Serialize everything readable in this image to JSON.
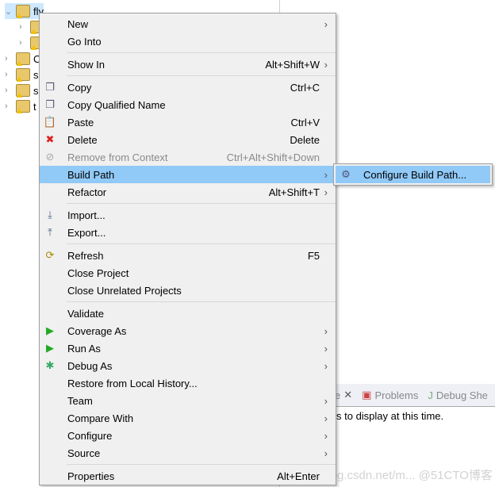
{
  "tree": {
    "items": [
      {
        "label": "fly",
        "expanded": true,
        "selected": true
      },
      {
        "label": "",
        "child": true,
        "icon": "library-icon"
      },
      {
        "label": "",
        "child": true,
        "icon": "package-icon"
      },
      {
        "label": "C"
      },
      {
        "label": "s"
      },
      {
        "label": "s"
      },
      {
        "label": "t"
      }
    ]
  },
  "bottom": {
    "tabs": [
      {
        "label": "e"
      },
      {
        "label": "Problems"
      },
      {
        "label": "Debug She"
      }
    ],
    "message": "s to display at this time."
  },
  "menu": {
    "items": [
      {
        "label": "New",
        "arrow": true
      },
      {
        "label": "Go Into"
      },
      {
        "sep": true
      },
      {
        "label": "Show In",
        "shortcut": "Alt+Shift+W",
        "arrow": true
      },
      {
        "sep": true
      },
      {
        "label": "Copy",
        "shortcut": "Ctrl+C",
        "icon": "copy-icon"
      },
      {
        "label": "Copy Qualified Name",
        "icon": "copy-qualified-icon"
      },
      {
        "label": "Paste",
        "shortcut": "Ctrl+V",
        "icon": "paste-icon"
      },
      {
        "label": "Delete",
        "shortcut": "Delete",
        "icon": "delete-icon"
      },
      {
        "label": "Remove from Context",
        "shortcut": "Ctrl+Alt+Shift+Down",
        "disabled": true,
        "icon": "remove-context-icon"
      },
      {
        "label": "Build Path",
        "arrow": true,
        "highlighted": true
      },
      {
        "label": "Refactor",
        "shortcut": "Alt+Shift+T",
        "arrow": true
      },
      {
        "sep": true
      },
      {
        "label": "Import...",
        "icon": "import-icon"
      },
      {
        "label": "Export...",
        "icon": "export-icon"
      },
      {
        "sep": true
      },
      {
        "label": "Refresh",
        "shortcut": "F5",
        "icon": "refresh-icon"
      },
      {
        "label": "Close Project"
      },
      {
        "label": "Close Unrelated Projects"
      },
      {
        "sep": true
      },
      {
        "label": "Validate"
      },
      {
        "label": "Coverage As",
        "arrow": true,
        "icon": "coverage-icon"
      },
      {
        "label": "Run As",
        "arrow": true,
        "icon": "run-icon"
      },
      {
        "label": "Debug As",
        "arrow": true,
        "icon": "debug-icon"
      },
      {
        "label": "Restore from Local History..."
      },
      {
        "label": "Team",
        "arrow": true
      },
      {
        "label": "Compare With",
        "arrow": true
      },
      {
        "label": "Configure",
        "arrow": true
      },
      {
        "label": "Source",
        "arrow": true
      },
      {
        "sep": true
      },
      {
        "label": "Properties",
        "shortcut": "Alt+Enter"
      }
    ]
  },
  "submenu": {
    "items": [
      {
        "label": "Configure Build Path...",
        "icon": "build-path-icon"
      }
    ]
  },
  "watermark": "https://blog.csdn.net/m... @51CTO博客",
  "colors": {
    "highlight": "#91c9f7",
    "menu_bg": "#f0f0f0"
  }
}
